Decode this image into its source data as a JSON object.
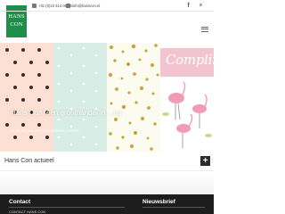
{
  "header": {
    "logo_line1": "HANS",
    "logo_line2": "CON",
    "phone": "+31 (0)10 414 06 25",
    "email": "info@hanscon.nl",
    "facebook_glyph": "f",
    "search_glyph": "⌕"
  },
  "hero": {
    "headline": "Hans Con, een groothandel in ...ng",
    "subline": "Ruim 45 jaar een betrouwbare partner...",
    "badge_word": "Complim",
    "colors": {
      "panel1": "#fbe0d3",
      "panel2": "#d8ede5",
      "panel3": "#fcfbf0",
      "badge": "#f2c4d0"
    }
  },
  "section": {
    "title": "Hans Con actueel",
    "plus": "+"
  },
  "footer": {
    "col1_title": "Contact",
    "col1_sub": "CONTACT HANS CON",
    "col2_title": "Nieuwsbrief"
  },
  "icons": [
    "phone-icon",
    "mail-icon",
    "facebook-icon",
    "search-icon",
    "menu-icon",
    "plus-icon"
  ],
  "colors": {
    "brand": "#1f8e4b",
    "footer": "#1d1d1d"
  }
}
